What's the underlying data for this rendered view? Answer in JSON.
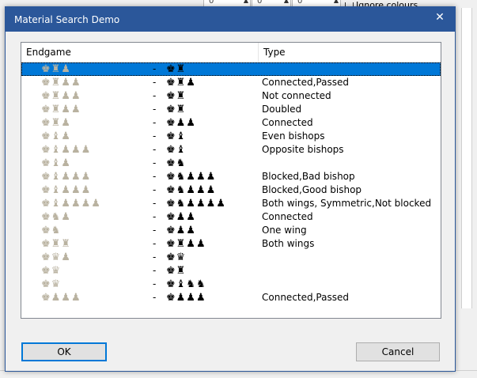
{
  "background": {
    "spin_values": [
      "0",
      "0",
      "0"
    ],
    "ignore_colours_label": "Ignore colours"
  },
  "dialog": {
    "title": "Material Search Demo",
    "close_glyph": "✕",
    "columns": {
      "endgame": "Endgame",
      "type": "Type"
    },
    "rows": [
      {
        "white": "♚♜♟",
        "dash": "-",
        "black": "♚♜",
        "type": ""
      },
      {
        "white": "♚♜♟♟",
        "dash": "-",
        "black": "♚♜♟",
        "type": "Connected,Passed"
      },
      {
        "white": "♚♜♟♟",
        "dash": "-",
        "black": "♚♜",
        "type": "Not connected"
      },
      {
        "white": "♚♜♟♟",
        "dash": "-",
        "black": "♚♜",
        "type": "Doubled"
      },
      {
        "white": "♚♜♟",
        "dash": "-",
        "black": "♚♟♟",
        "type": "Connected"
      },
      {
        "white": "♚♝♟",
        "dash": "-",
        "black": "♚♝",
        "type": "Even bishops"
      },
      {
        "white": "♚♝♟♟♟",
        "dash": "-",
        "black": "♚♝",
        "type": "Opposite bishops"
      },
      {
        "white": "♚♝♟",
        "dash": "-",
        "black": "♚♞",
        "type": ""
      },
      {
        "white": "♚♝♟♟♟",
        "dash": "-",
        "black": "♚♞♟♟♟",
        "type": "Blocked,Bad bishop"
      },
      {
        "white": "♚♝♟♟♟",
        "dash": "-",
        "black": "♚♞♟♟♟",
        "type": "Blocked,Good bishop"
      },
      {
        "white": "♚♝♟♟♟♟",
        "dash": "-",
        "black": "♚♞♟♟♟♟",
        "type": "Both wings, Symmetric,Not blocked"
      },
      {
        "white": "♚♞♟",
        "dash": "-",
        "black": "♚♟♟",
        "type": "Connected"
      },
      {
        "white": "♚♞",
        "dash": "-",
        "black": "♚♟♟",
        "type": "One wing"
      },
      {
        "white": "♚♜♜",
        "dash": "-",
        "black": "♚♜♟♟",
        "type": "Both wings"
      },
      {
        "white": "♚♛♟",
        "dash": "-",
        "black": "♚♛",
        "type": ""
      },
      {
        "white": "♚♛",
        "dash": "-",
        "black": "♚♜",
        "type": ""
      },
      {
        "white": "♚♛",
        "dash": "-",
        "black": "♚♝♞♞",
        "type": ""
      },
      {
        "white": "♚♟♟♟",
        "dash": "-",
        "black": "♚♟♟♟",
        "type": "Connected,Passed"
      }
    ],
    "selected_row": 0,
    "ok_label": "OK",
    "cancel_label": "Cancel"
  },
  "colors": {
    "titlebar": "#2b579a",
    "selection": "#0078d7",
    "white_piece": "#b9b2a0",
    "black_piece": "#000000"
  }
}
